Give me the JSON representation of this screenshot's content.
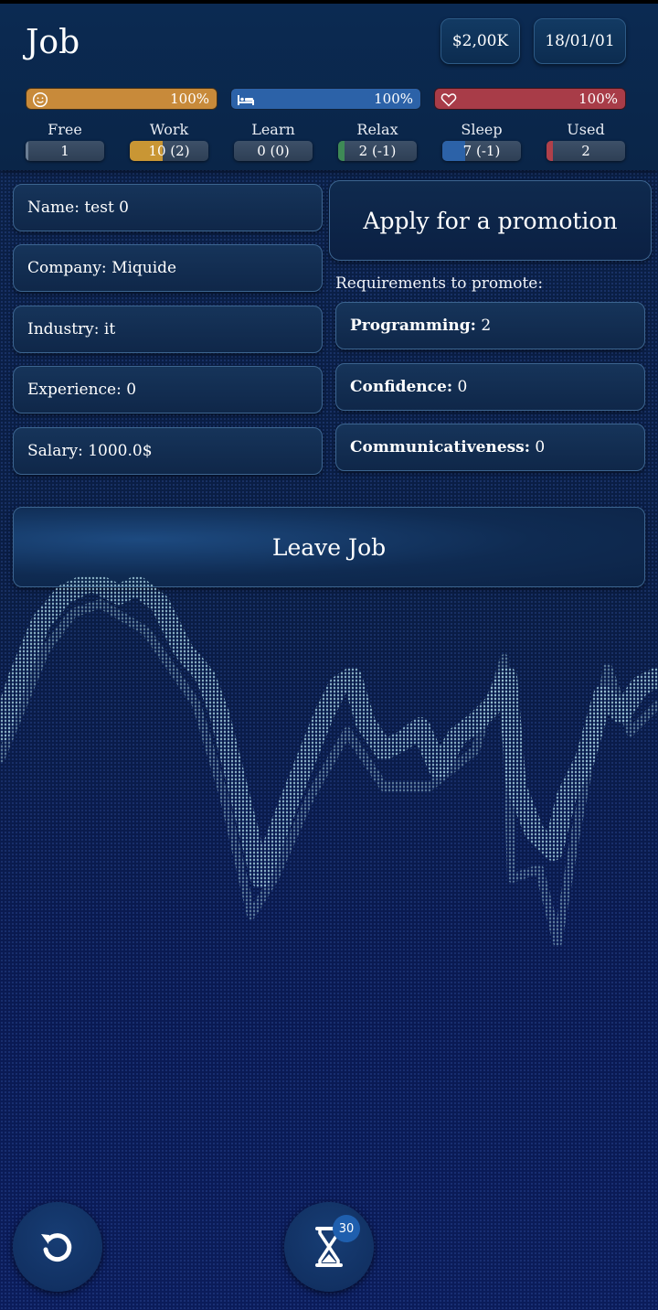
{
  "header": {
    "title": "Job",
    "money": "$2,00K",
    "date": "18/01/01"
  },
  "stats": {
    "happiness": {
      "icon": "smiley-icon",
      "percent": "100%",
      "color": "#c88a3a",
      "level": 1.0
    },
    "energy": {
      "icon": "bed-icon",
      "percent": "100%",
      "color": "#2c62a8",
      "level": 1.0
    },
    "health": {
      "icon": "heart-icon",
      "percent": "100%",
      "color": "#a83c48",
      "level": 1.0
    }
  },
  "time": [
    {
      "label": "Free",
      "value": "1",
      "color": "#6a7d94",
      "level": 0.04
    },
    {
      "label": "Work",
      "value": "10 (2)",
      "color": "#c99634",
      "level": 0.42
    },
    {
      "label": "Learn",
      "value": "0 (0)",
      "color": "#6a7d94",
      "level": 0.0
    },
    {
      "label": "Relax",
      "value": "2 (-1)",
      "color": "#3e8a56",
      "level": 0.08
    },
    {
      "label": "Sleep",
      "value": "7 (-1)",
      "color": "#2c62a8",
      "level": 0.29
    },
    {
      "label": "Used",
      "value": "2",
      "color": "#b0404a",
      "level": 0.08
    }
  ],
  "job": {
    "name": "Name: test 0",
    "company": "Company: Miquide",
    "industry": "Industry: it",
    "experience": "Experience: 0",
    "salary": "Salary: 1000.0$"
  },
  "promotion": {
    "button": "Apply for a promotion",
    "requirements_label": "Requirements to promote:",
    "requirements": [
      {
        "skill": "Programming:",
        "value": "2"
      },
      {
        "skill": "Confidence:",
        "value": "0"
      },
      {
        "skill": "Communicativeness:",
        "value": "0"
      }
    ]
  },
  "leave_button": "Leave Job",
  "footer": {
    "undo_icon": "undo-icon",
    "hourglass_icon": "hourglass-icon",
    "hourglass_badge": "30"
  }
}
